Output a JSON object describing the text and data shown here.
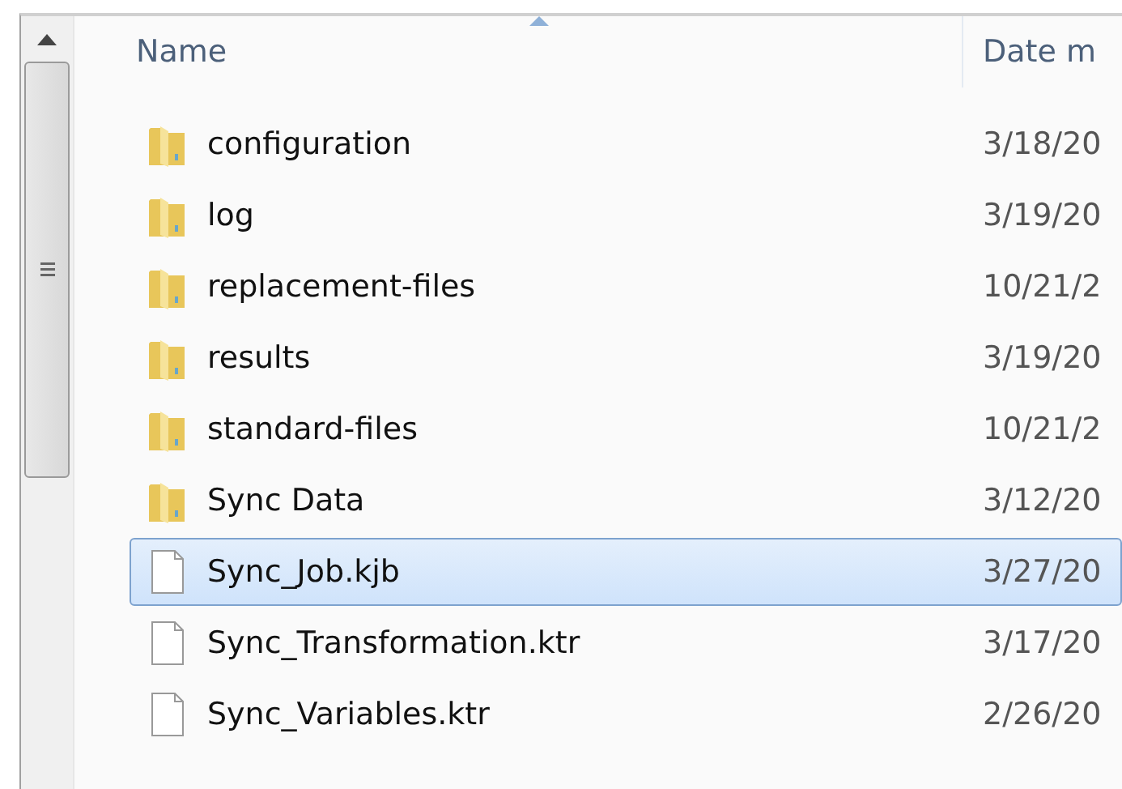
{
  "columns": [
    {
      "label": "Name",
      "sorted": true
    },
    {
      "label": "Date m",
      "sorted": false
    }
  ],
  "rows": [
    {
      "kind": "folder",
      "name": "configuration",
      "date": "3/18/20",
      "selected": false
    },
    {
      "kind": "folder",
      "name": "log",
      "date": "3/19/20",
      "selected": false
    },
    {
      "kind": "folder",
      "name": "replacement-files",
      "date": "10/21/2",
      "selected": false
    },
    {
      "kind": "folder",
      "name": "results",
      "date": "3/19/20",
      "selected": false
    },
    {
      "kind": "folder",
      "name": "standard-files",
      "date": "10/21/2",
      "selected": false
    },
    {
      "kind": "folder",
      "name": "Sync Data",
      "date": "3/12/20",
      "selected": false
    },
    {
      "kind": "file",
      "name": "Sync_Job.kjb",
      "date": "3/27/20",
      "selected": true
    },
    {
      "kind": "file",
      "name": "Sync_Transformation.ktr",
      "date": "3/17/20",
      "selected": false
    },
    {
      "kind": "file",
      "name": "Sync_Variables.ktr",
      "date": "2/26/20",
      "selected": false
    }
  ]
}
